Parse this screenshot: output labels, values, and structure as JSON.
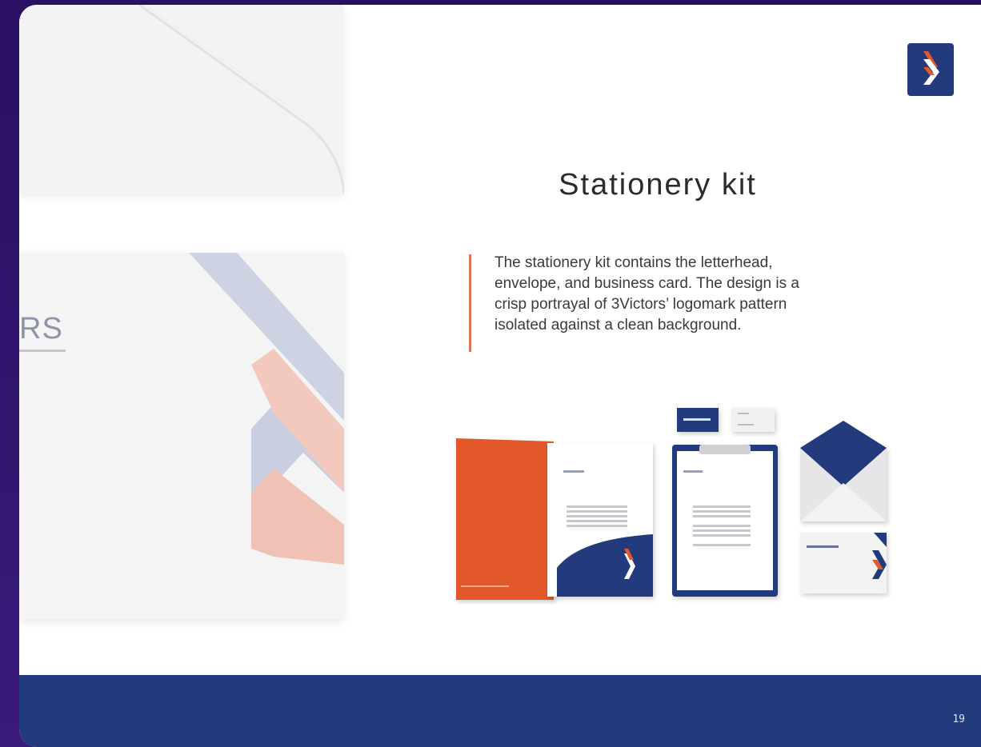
{
  "slide": {
    "title": "Stationery kit",
    "description_lines": [
      "The stationery kit contains the letterhead,",
      "envelope, and business card. The design is a",
      "crisp portrayal of 3Victors’ logomark pattern",
      "isolated against a clean background."
    ],
    "brand_partial": "RS",
    "page_number": "19"
  },
  "colors": {
    "navy": "#233a7d",
    "orange": "#e2592a",
    "accent_rule": "#d9775a",
    "background_purple": "#2a0f63"
  },
  "icons": {
    "logo": "chevron-logomark-icon"
  }
}
